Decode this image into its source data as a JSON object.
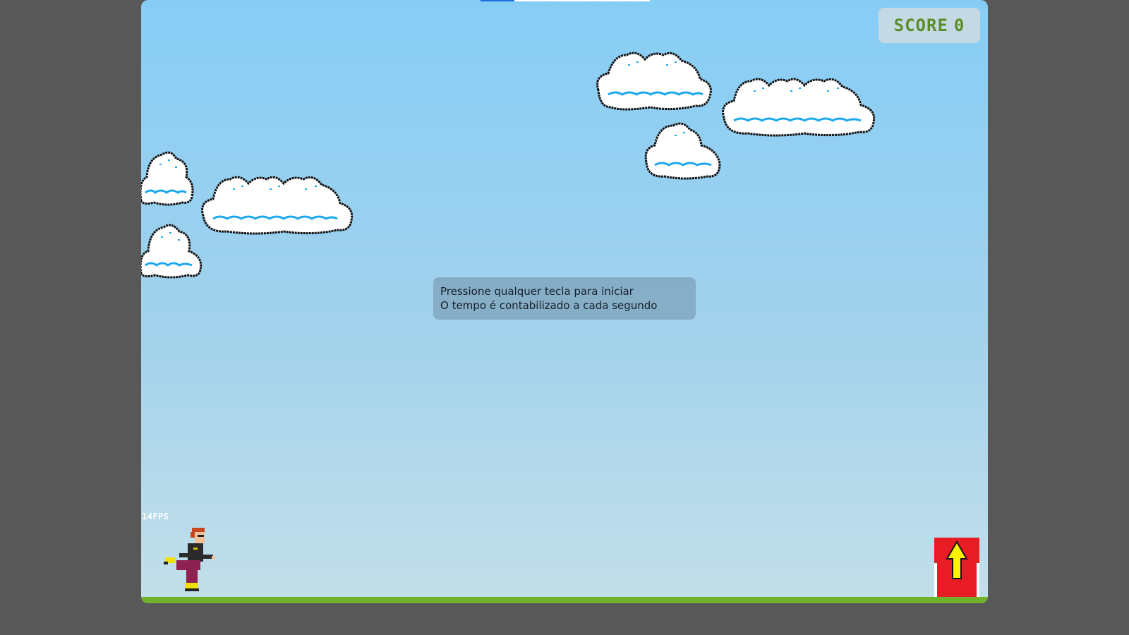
{
  "game": {
    "score_label": "SCORE",
    "score_value": "0",
    "instructions": {
      "line1": "Pressione qualquer tecla para iniciar",
      "line2": "O tempo é contabilizado a cada segundo"
    },
    "fps_text": "14FPS"
  },
  "colors": {
    "sky_top": "#86cdf6",
    "sky_bottom": "#c3dfe9",
    "ground": "#71b22b",
    "score_text": "#5a8e2a",
    "obstacle_red": "#e81c24",
    "arrow_yellow": "#fff200",
    "cloud_accent": "#1ba8ef"
  },
  "icons": {
    "player": "runner-sprite",
    "obstacle": "up-arrow-block",
    "clouds": "pixel-cloud"
  }
}
